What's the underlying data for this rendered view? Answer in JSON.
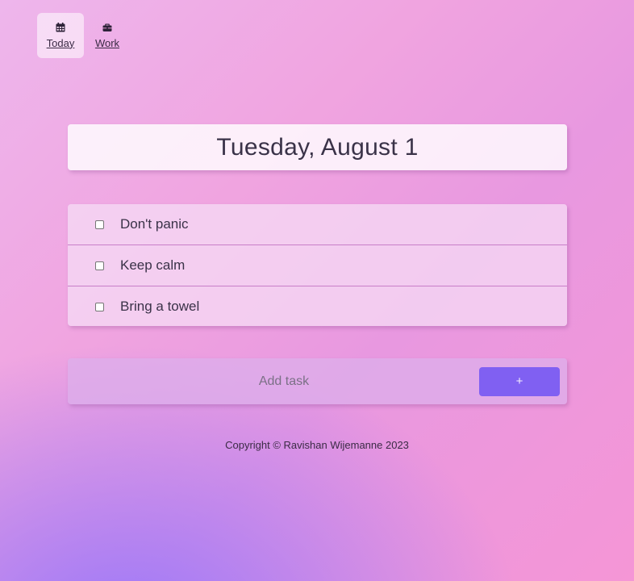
{
  "nav": {
    "items": [
      {
        "label": "Today",
        "icon": "calendar-icon",
        "active": true
      },
      {
        "label": "Work",
        "icon": "briefcase-icon",
        "active": false
      }
    ]
  },
  "header": {
    "date": "Tuesday, August 1"
  },
  "tasks": [
    {
      "text": "Don't panic",
      "checked": false
    },
    {
      "text": "Keep calm",
      "checked": false
    },
    {
      "text": "Bring a towel",
      "checked": false
    }
  ],
  "add_task": {
    "placeholder": "Add task",
    "value": "",
    "button_label": "+"
  },
  "footer": {
    "text": "Copyright © Ravishan Wijemanne 2023"
  },
  "colors": {
    "accent": "#8060f2",
    "gradient_bottom_left": "#9676fa",
    "gradient_top_right": "#f596d6"
  }
}
